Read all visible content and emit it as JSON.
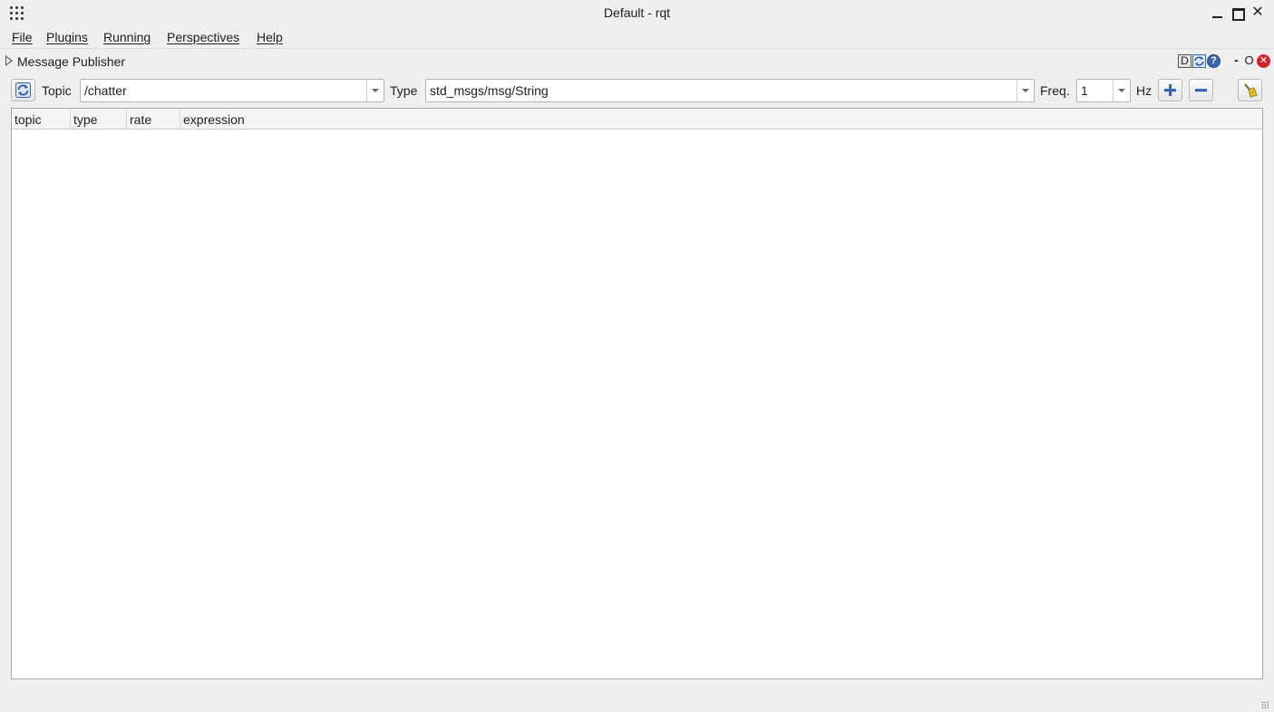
{
  "window": {
    "title": "Default - rqt"
  },
  "menu": [
    "File",
    "Plugins",
    "Running",
    "Perspectives",
    "Help"
  ],
  "dock": {
    "title": "Message Publisher",
    "buttons": {
      "d_label": "D",
      "minimize_label": "-",
      "float_label": "O"
    }
  },
  "toolbar": {
    "topic_label": "Topic",
    "topic_value": "/chatter",
    "type_label": "Type",
    "type_value": "std_msgs/msg/String",
    "freq_label": "Freq.",
    "freq_value": "1",
    "hz_label": "Hz"
  },
  "table": {
    "columns": [
      "topic",
      "type",
      "rate",
      "expression"
    ],
    "rows": []
  },
  "icons": {
    "app": "app-grid-icon",
    "refresh": "refresh-icon",
    "add": "plus-icon",
    "remove": "minus-icon",
    "clear": "broom-icon",
    "help": "help-icon",
    "close": "close-icon"
  },
  "colors": {
    "background": "#efefef",
    "accent_blue": "#3a67b5",
    "close_red": "#d2232a"
  }
}
